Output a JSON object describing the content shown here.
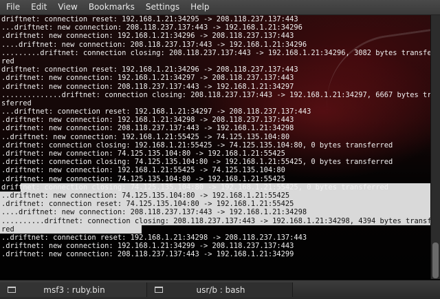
{
  "menubar": {
    "items": [
      "File",
      "Edit",
      "View",
      "Bookmarks",
      "Settings",
      "Help"
    ]
  },
  "terminal": {
    "lines": [
      "driftnet: connection reset: 192.168.1.21:34295 -> 208.118.237.137:443",
      "...driftnet: new connection: 208.118.237.137:443 -> 192.168.1.21:34296",
      ".driftnet: new connection: 192.168.1.21:34296 -> 208.118.237.137:443",
      "....driftnet: new connection: 208.118.237.137:443 -> 192.168.1.21:34296",
      ".........driftnet: connection closing: 208.118.237.137:443 -> 192.168.1.21:34296, 3082 bytes transfer",
      "red",
      "driftnet: connection reset: 192.168.1.21:34296 -> 208.118.237.137:443",
      ".driftnet: new connection: 192.168.1.21:34297 -> 208.118.237.137:443",
      ".driftnet: new connection: 208.118.237.137:443 -> 192.168.1.21:34297",
      "..............driftnet: connection closing: 208.118.237.137:443 -> 192.168.1.21:34297, 6667 bytes tran",
      "sferred",
      "...driftnet: connection reset: 192.168.1.21:34297 -> 208.118.237.137:443",
      ".driftnet: new connection: 192.168.1.21:34298 -> 208.118.237.137:443",
      ".driftnet: new connection: 208.118.237.137:443 -> 192.168.1.21:34298",
      "..driftnet: new connection: 192.168.1.21:55425 -> 74.125.135.104:80",
      ".driftnet: connection closing: 192.168.1.21:55425 -> 74.125.135.104:80, 0 bytes transferred",
      ".driftnet: new connection: 74.125.135.104:80 -> 192.168.1.21:55425",
      ".driftnet: connection closing: 74.125.135.104:80 -> 192.168.1.21:55425, 0 bytes transferred",
      ".driftnet: new connection: 192.168.1.21:55425 -> 74.125.135.104:80",
      ".driftnet: new connection: 74.125.135.104:80 -> 192.168.1.21:55425",
      "driftnet: connection closing: 74.125.135.104:80 -> 192.168.1.21:55425, 0 bytes transferred",
      "..driftnet: new connection: 74.125.135.104:80 -> 192.168.1.21:55425",
      ".driftnet: connection reset: 74.125.135.104:80 -> 192.168.1.21:55425",
      "....driftnet: new connection: 208.118.237.137:443 -> 192.168.1.21:34298",
      "..........driftnet: connection closing: 208.118.237.137:443 -> 192.168.1.21:34298, 4394 bytes transfer",
      "red",
      "..driftnet: connection reset: 192.168.1.21:34298 -> 208.118.237.137:443",
      ".driftnet: new connection: 192.168.1.21:34299 -> 208.118.237.137:443",
      ".driftnet: new connection: 208.118.237.137:443 -> 192.168.1.21:34299"
    ]
  },
  "tabs": [
    {
      "label": "msf3 : ruby.bin",
      "icon": "terminal-icon"
    },
    {
      "label": "usr/b : bash",
      "icon": "terminal-icon"
    }
  ]
}
